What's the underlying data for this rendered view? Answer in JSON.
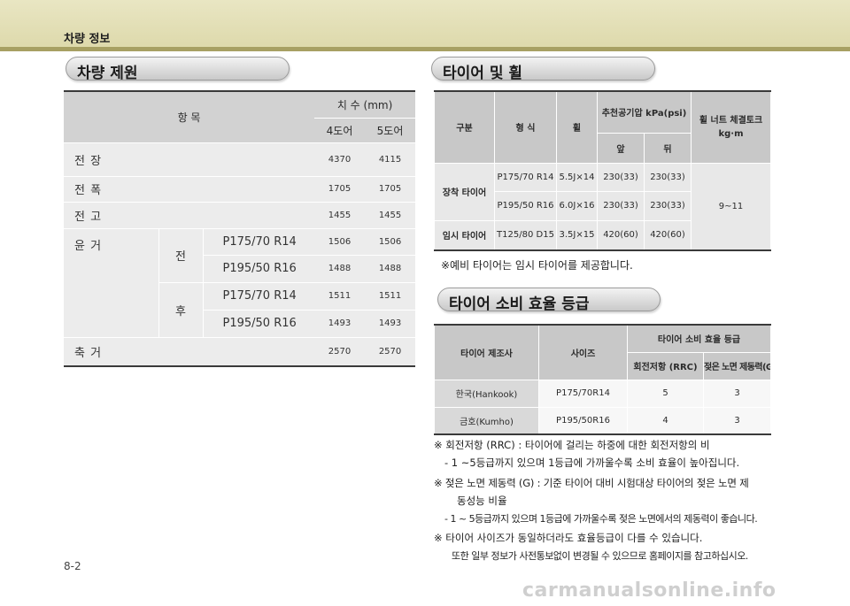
{
  "header": {
    "title": "차량 정보"
  },
  "sections": {
    "spec_title": "차량 제원",
    "tire_title": "타이어 및 휠",
    "eff_title": "타이어 소비 효율 등급"
  },
  "spec_table": {
    "h_item": "항 목",
    "h_dim": "치 수 (mm)",
    "h_4door": "4도어",
    "h_5door": "5도어",
    "rows": {
      "length": {
        "label": "전 장",
        "v4": "4370",
        "v5": "4115"
      },
      "width": {
        "label": "전 폭",
        "v4": "1705",
        "v5": "1705"
      },
      "height": {
        "label": "전 고",
        "v4": "1455",
        "v5": "1455"
      },
      "tread": {
        "label": "윤 거",
        "front": "전",
        "rear": "후",
        "f1": {
          "tire": "P175/70 R14",
          "v4": "1506",
          "v5": "1506"
        },
        "f2": {
          "tire": "P195/50 R16",
          "v4": "1488",
          "v5": "1488"
        },
        "r1": {
          "tire": "P175/70 R14",
          "v4": "1511",
          "v5": "1511"
        },
        "r2": {
          "tire": "P195/50 R16",
          "v4": "1493",
          "v5": "1493"
        }
      },
      "wheelbase": {
        "label": "축 거",
        "v4": "2570",
        "v5": "2570"
      }
    }
  },
  "tire_table": {
    "h_class": "구분",
    "h_type": "형 식",
    "h_wheel": "휠",
    "h_pressure": "추천공기압 kPa(psi)",
    "h_torque": "휠 너트 체결토크 kg·m",
    "h_front": "앞",
    "h_rear": "뒤",
    "installed": "장착 타이어",
    "temporary": "임시 타이어",
    "torque_value": "9~11",
    "rows": {
      "r1": {
        "type": "P175/70 R14",
        "wheel": "5.5J×14",
        "front": "230(33)",
        "rear": "230(33)"
      },
      "r2": {
        "type": "P195/50 R16",
        "wheel": "6.0J×16",
        "front": "230(33)",
        "rear": "230(33)"
      },
      "r3": {
        "type": "T125/80 D15",
        "wheel": "3.5J×15",
        "front": "420(60)",
        "rear": "420(60)"
      }
    },
    "note": "※예비 타이어는 임시 타이어를 제공합니다."
  },
  "eff_table": {
    "h_maker": "타이어 제조사",
    "h_size": "사이즈",
    "h_grade": "타이어 소비 효율 등급",
    "h_rrc": "회전저항 (RRC)",
    "h_g": "젖은 노면 제동력(G)",
    "rows": {
      "r1": {
        "maker": "한국(Hankook)",
        "size": "P175/70R14",
        "rrc": "5",
        "g": "3"
      },
      "r2": {
        "maker": "금호(Kumho)",
        "size": "P195/50R16",
        "rrc": "4",
        "g": "3"
      }
    }
  },
  "notes": {
    "n1": "※ 회전저항 (RRC) : 타이어에 걸리는 하중에 대한 회전저항의 비",
    "n2": "- 1 ~5등급까지 있으며 1등급에 가까울수록 소비 효율이 높아집니다.",
    "n3": "※ 젖은 노면 제동력 (G) : 기준 타이어 대비 시험대상 타이어의 젖은 노면 제",
    "n4": "동성능 비율",
    "n5": "- 1 ~ 5등급까지 있으며 1등급에 가까울수록 젖은 노면에서의 제동력이 좋습니다.",
    "n6": "※ 타이어 사이즈가 동일하더라도 효율등급이 다를 수 있습니다.",
    "n7": "또한 일부 정보가 사전통보없이 변경될 수 있으므로 홈페이지를 참고하십시오."
  },
  "footer": {
    "page": "8-2",
    "watermark": "carmanualsonline.info"
  }
}
